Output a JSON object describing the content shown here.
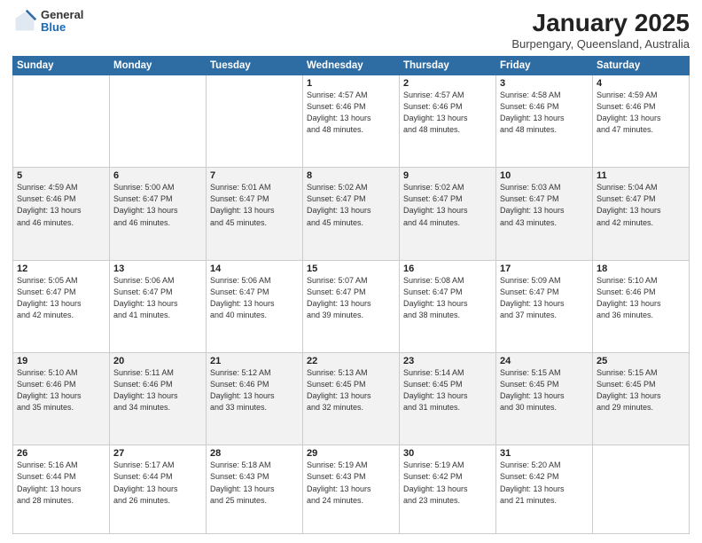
{
  "header": {
    "logo_general": "General",
    "logo_blue": "Blue",
    "month": "January 2025",
    "location": "Burpengary, Queensland, Australia"
  },
  "days_of_week": [
    "Sunday",
    "Monday",
    "Tuesday",
    "Wednesday",
    "Thursday",
    "Friday",
    "Saturday"
  ],
  "weeks": [
    [
      {
        "day": "",
        "info": ""
      },
      {
        "day": "",
        "info": ""
      },
      {
        "day": "",
        "info": ""
      },
      {
        "day": "1",
        "info": "Sunrise: 4:57 AM\nSunset: 6:46 PM\nDaylight: 13 hours\nand 48 minutes."
      },
      {
        "day": "2",
        "info": "Sunrise: 4:57 AM\nSunset: 6:46 PM\nDaylight: 13 hours\nand 48 minutes."
      },
      {
        "day": "3",
        "info": "Sunrise: 4:58 AM\nSunset: 6:46 PM\nDaylight: 13 hours\nand 48 minutes."
      },
      {
        "day": "4",
        "info": "Sunrise: 4:59 AM\nSunset: 6:46 PM\nDaylight: 13 hours\nand 47 minutes."
      }
    ],
    [
      {
        "day": "5",
        "info": "Sunrise: 4:59 AM\nSunset: 6:46 PM\nDaylight: 13 hours\nand 46 minutes."
      },
      {
        "day": "6",
        "info": "Sunrise: 5:00 AM\nSunset: 6:47 PM\nDaylight: 13 hours\nand 46 minutes."
      },
      {
        "day": "7",
        "info": "Sunrise: 5:01 AM\nSunset: 6:47 PM\nDaylight: 13 hours\nand 45 minutes."
      },
      {
        "day": "8",
        "info": "Sunrise: 5:02 AM\nSunset: 6:47 PM\nDaylight: 13 hours\nand 45 minutes."
      },
      {
        "day": "9",
        "info": "Sunrise: 5:02 AM\nSunset: 6:47 PM\nDaylight: 13 hours\nand 44 minutes."
      },
      {
        "day": "10",
        "info": "Sunrise: 5:03 AM\nSunset: 6:47 PM\nDaylight: 13 hours\nand 43 minutes."
      },
      {
        "day": "11",
        "info": "Sunrise: 5:04 AM\nSunset: 6:47 PM\nDaylight: 13 hours\nand 42 minutes."
      }
    ],
    [
      {
        "day": "12",
        "info": "Sunrise: 5:05 AM\nSunset: 6:47 PM\nDaylight: 13 hours\nand 42 minutes."
      },
      {
        "day": "13",
        "info": "Sunrise: 5:06 AM\nSunset: 6:47 PM\nDaylight: 13 hours\nand 41 minutes."
      },
      {
        "day": "14",
        "info": "Sunrise: 5:06 AM\nSunset: 6:47 PM\nDaylight: 13 hours\nand 40 minutes."
      },
      {
        "day": "15",
        "info": "Sunrise: 5:07 AM\nSunset: 6:47 PM\nDaylight: 13 hours\nand 39 minutes."
      },
      {
        "day": "16",
        "info": "Sunrise: 5:08 AM\nSunset: 6:47 PM\nDaylight: 13 hours\nand 38 minutes."
      },
      {
        "day": "17",
        "info": "Sunrise: 5:09 AM\nSunset: 6:47 PM\nDaylight: 13 hours\nand 37 minutes."
      },
      {
        "day": "18",
        "info": "Sunrise: 5:10 AM\nSunset: 6:46 PM\nDaylight: 13 hours\nand 36 minutes."
      }
    ],
    [
      {
        "day": "19",
        "info": "Sunrise: 5:10 AM\nSunset: 6:46 PM\nDaylight: 13 hours\nand 35 minutes."
      },
      {
        "day": "20",
        "info": "Sunrise: 5:11 AM\nSunset: 6:46 PM\nDaylight: 13 hours\nand 34 minutes."
      },
      {
        "day": "21",
        "info": "Sunrise: 5:12 AM\nSunset: 6:46 PM\nDaylight: 13 hours\nand 33 minutes."
      },
      {
        "day": "22",
        "info": "Sunrise: 5:13 AM\nSunset: 6:45 PM\nDaylight: 13 hours\nand 32 minutes."
      },
      {
        "day": "23",
        "info": "Sunrise: 5:14 AM\nSunset: 6:45 PM\nDaylight: 13 hours\nand 31 minutes."
      },
      {
        "day": "24",
        "info": "Sunrise: 5:15 AM\nSunset: 6:45 PM\nDaylight: 13 hours\nand 30 minutes."
      },
      {
        "day": "25",
        "info": "Sunrise: 5:15 AM\nSunset: 6:45 PM\nDaylight: 13 hours\nand 29 minutes."
      }
    ],
    [
      {
        "day": "26",
        "info": "Sunrise: 5:16 AM\nSunset: 6:44 PM\nDaylight: 13 hours\nand 28 minutes."
      },
      {
        "day": "27",
        "info": "Sunrise: 5:17 AM\nSunset: 6:44 PM\nDaylight: 13 hours\nand 26 minutes."
      },
      {
        "day": "28",
        "info": "Sunrise: 5:18 AM\nSunset: 6:43 PM\nDaylight: 13 hours\nand 25 minutes."
      },
      {
        "day": "29",
        "info": "Sunrise: 5:19 AM\nSunset: 6:43 PM\nDaylight: 13 hours\nand 24 minutes."
      },
      {
        "day": "30",
        "info": "Sunrise: 5:19 AM\nSunset: 6:42 PM\nDaylight: 13 hours\nand 23 minutes."
      },
      {
        "day": "31",
        "info": "Sunrise: 5:20 AM\nSunset: 6:42 PM\nDaylight: 13 hours\nand 21 minutes."
      },
      {
        "day": "",
        "info": ""
      }
    ]
  ]
}
